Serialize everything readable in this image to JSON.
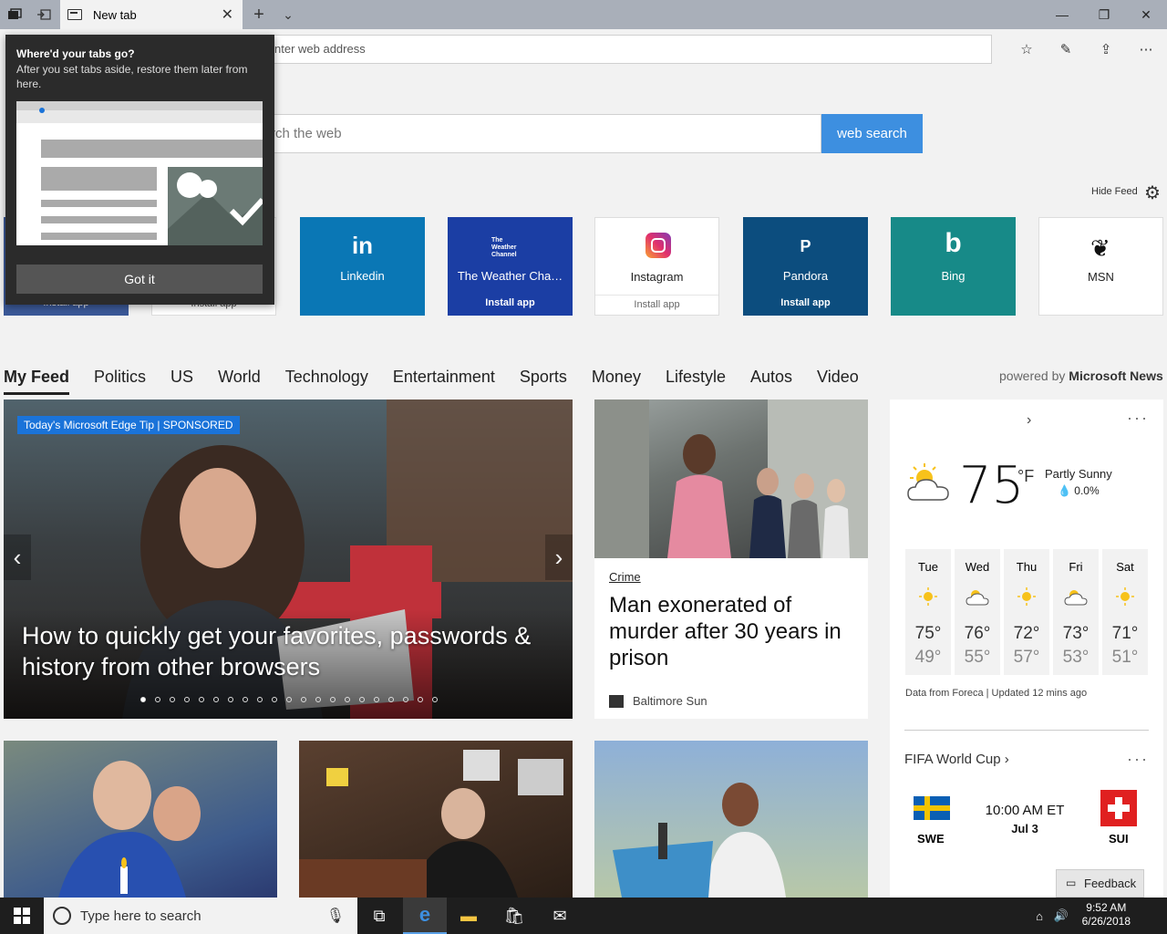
{
  "browser": {
    "tab_title": "New tab",
    "new_tab": "+",
    "tab_menu": "⌄",
    "minimize": "—",
    "restore": "❐",
    "close": "✕",
    "address_placeholder": "nter web address",
    "tools": [
      "☆",
      "✎",
      "⇪",
      "⋯"
    ]
  },
  "popup": {
    "title": "Where'd your tabs go?",
    "body": "After you set tabs aside, restore them later from here.",
    "button": "Got it"
  },
  "search": {
    "placeholder": "rch the web",
    "button": "web search"
  },
  "feed_controls": {
    "hide_feed": "Hide Feed"
  },
  "tiles": [
    {
      "label": "",
      "install": "Install app",
      "color": "#3b5998"
    },
    {
      "label": "",
      "install": "Install app",
      "color": "#ffffff"
    },
    {
      "label": "Linkedin",
      "logo": "in",
      "install": "",
      "color": "#0a77b5"
    },
    {
      "label": "The Weather Cha…",
      "logo": "The Weather Channel",
      "install": "Install app",
      "color": "#1b3ea4"
    },
    {
      "label": "Instagram",
      "logo": "",
      "install": "Install app",
      "color": "#ffffff"
    },
    {
      "label": "Pandora",
      "logo": "P",
      "install": "Install app",
      "color": "#0c4d7e"
    },
    {
      "label": "Bing",
      "logo": "b",
      "install": "",
      "color": "#178a88"
    },
    {
      "label": "MSN",
      "logo": "",
      "install": "",
      "color": "#ffffff"
    }
  ],
  "news_nav": {
    "items": [
      "My Feed",
      "Politics",
      "US",
      "World",
      "Technology",
      "Entertainment",
      "Sports",
      "Money",
      "Lifestyle",
      "Autos",
      "Video"
    ],
    "powered_prefix": "powered by",
    "powered_brand": "Microsoft News"
  },
  "hero": {
    "badge": "Today's Microsoft Edge Tip | SPONSORED",
    "title": "How to quickly get your favorites, passwords & history from other browsers",
    "prev": "‹",
    "next": "›",
    "slide_count": 21,
    "current_slide": 1
  },
  "crime_card": {
    "category": "Crime",
    "title": "Man exonerated of murder after 30 years in prison",
    "source": "Baltimore Sun"
  },
  "weather": {
    "chevron": "›",
    "more": "···",
    "temp": "75",
    "unit": "°F",
    "condition": "Partly Sunny",
    "precip": "0.0%",
    "days": [
      {
        "name": "Tue",
        "hi": "75°",
        "lo": "49°",
        "icon": "sun-icon"
      },
      {
        "name": "Wed",
        "hi": "76°",
        "lo": "55°",
        "icon": "partly-cloudy-icon"
      },
      {
        "name": "Thu",
        "hi": "72°",
        "lo": "57°",
        "icon": "sun-icon"
      },
      {
        "name": "Fri",
        "hi": "73°",
        "lo": "53°",
        "icon": "partly-cloudy-icon"
      },
      {
        "name": "Sat",
        "hi": "71°",
        "lo": "51°",
        "icon": "sun-icon"
      }
    ],
    "source": "Data from Foreca | Updated 12 mins ago"
  },
  "fifa": {
    "title": "FIFA World Cup ›",
    "more": "···",
    "home": "SWE",
    "away": "SUI",
    "time": "10:00 AM ET",
    "date": "Jul 3"
  },
  "feedback": {
    "label": "Feedback"
  },
  "taskbar": {
    "search_placeholder": "Type here to search",
    "time": "9:52 AM",
    "date": "6/26/2018"
  }
}
